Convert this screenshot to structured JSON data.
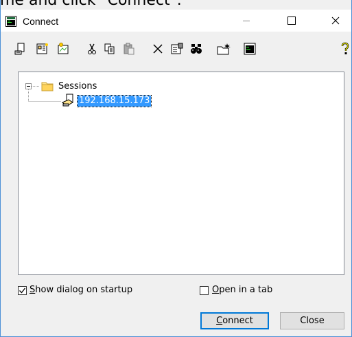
{
  "banner": {
    "text": "me and click \"Connect\"."
  },
  "window": {
    "title": "Connect",
    "controls": [
      "minimize",
      "maximize",
      "close"
    ]
  },
  "toolbar": {
    "icons": [
      "quick-connect-icon",
      "new-session-icon",
      "edit-session-icon",
      "cut-icon",
      "copy-icon",
      "paste-icon",
      "delete-icon",
      "properties-icon",
      "find-icon",
      "new-folder-icon",
      "terminal-icon",
      "help-icon"
    ]
  },
  "tree": {
    "root": {
      "label": "Sessions",
      "expanded": true
    },
    "children": [
      {
        "label": "192.168.15.173",
        "selected": true
      }
    ]
  },
  "options": {
    "show_dialog": {
      "prefix": "S",
      "rest": "how dialog on startup",
      "checked": true
    },
    "open_tab": {
      "prefix": "O",
      "rest": "pen in a tab",
      "checked": false
    }
  },
  "buttons": {
    "connect": {
      "prefix": "C",
      "rest": "onnect"
    },
    "close": "Close"
  },
  "colors": {
    "selection": "#3399ff",
    "default_button_border": "#0078d7"
  }
}
